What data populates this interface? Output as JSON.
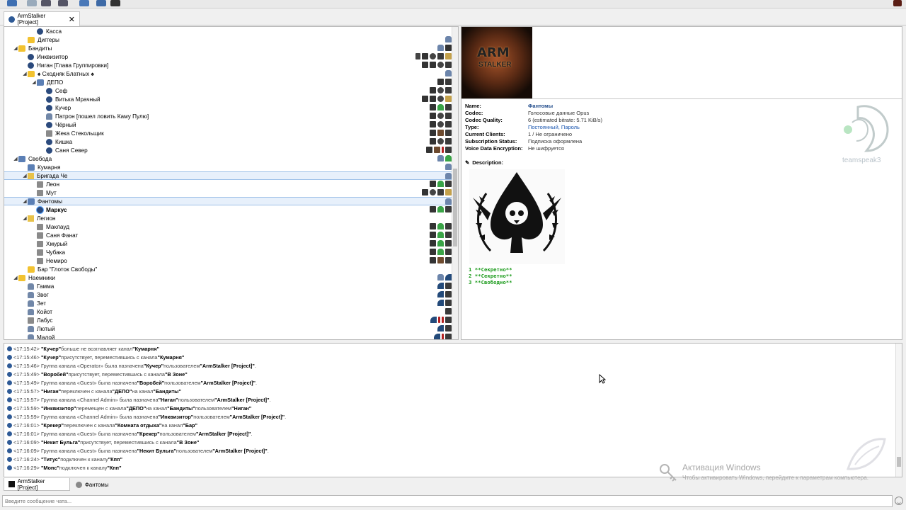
{
  "toolbar": {
    "icons": [
      "connect-icon",
      "disconnect-icon",
      "mute-microphone-icon",
      "mute-speakers-icon",
      "away-icon",
      "bookmarks-icon",
      "identity-icon"
    ]
  },
  "server_tab": {
    "label": "ArmStalker [Project]",
    "close": "✕"
  },
  "tree": {
    "rows": [
      {
        "indent": 4,
        "icon": "user",
        "label": "Касса",
        "badges": []
      },
      {
        "indent": 3,
        "icon": "chan",
        "label": "Диггеры",
        "badges": [
          "lk"
        ]
      },
      {
        "indent": 2,
        "icon": "chan",
        "label": "Бандиты",
        "expanded": true,
        "badges": [
          "lk",
          "g"
        ]
      },
      {
        "indent": 3,
        "icon": "user",
        "label": "Инквизитор",
        "badges": [
          "mic",
          "g",
          "sk",
          "dk",
          "yl"
        ]
      },
      {
        "indent": 3,
        "icon": "user",
        "label": "Ниган [Глава Группировки]",
        "badges": [
          "g",
          "g",
          "sk",
          "dk"
        ]
      },
      {
        "indent": 3,
        "icon": "chan",
        "label": "♠ Сходняк Блатных ♠",
        "expanded": true,
        "badges": [
          "lk"
        ]
      },
      {
        "indent": 4,
        "icon": "chan-blue",
        "label": "ДЕПО",
        "expanded": true,
        "badges": [
          "g",
          "dk"
        ]
      },
      {
        "indent": 5,
        "icon": "user",
        "label": "Сеф",
        "badges": [
          "g",
          "sk",
          "dk"
        ]
      },
      {
        "indent": 5,
        "icon": "user",
        "label": "Витька Мрачный",
        "badges": [
          "g",
          "g",
          "sk",
          "yl"
        ]
      },
      {
        "indent": 5,
        "icon": "user",
        "label": "Кучер",
        "badges": [
          "g",
          "gr",
          "dk"
        ]
      },
      {
        "indent": 5,
        "icon": "lock",
        "label": "Патрон [пошел ловить Каму Пулю]",
        "badges": [
          "g",
          "sk",
          "dk"
        ]
      },
      {
        "indent": 5,
        "icon": "user",
        "label": "Чёрный",
        "badges": [
          "g",
          "sk",
          "dk"
        ]
      },
      {
        "indent": 5,
        "icon": "mute",
        "label": "Жека Стекольщик",
        "badges": [
          "g",
          "br",
          "dk"
        ]
      },
      {
        "indent": 5,
        "icon": "user",
        "label": "Кишка",
        "badges": [
          "g",
          "sk",
          "dk"
        ]
      },
      {
        "indent": 5,
        "icon": "user",
        "label": "Саня Север",
        "badges": [
          "g",
          "br",
          "rd",
          "dk"
        ]
      },
      {
        "indent": 2,
        "icon": "chan-blue",
        "label": "Свобода",
        "expanded": true,
        "badges": [
          "lk",
          "gr"
        ]
      },
      {
        "indent": 3,
        "icon": "chan-blue",
        "label": "Кумарня",
        "badges": [
          "lk"
        ]
      },
      {
        "indent": 3,
        "icon": "flag",
        "label": "Бригада Че",
        "expanded": true,
        "selected": true,
        "badges": [
          "lk"
        ]
      },
      {
        "indent": 4,
        "icon": "mute",
        "label": "Леон",
        "badges": [
          "g",
          "gr",
          "dk"
        ]
      },
      {
        "indent": 4,
        "icon": "mute",
        "label": "Мут",
        "badges": [
          "g",
          "sk",
          "dk",
          "yl"
        ]
      },
      {
        "indent": 3,
        "icon": "chan-blue",
        "label": "Фантомы",
        "expanded": true,
        "selected": true,
        "badges": [
          "lk"
        ]
      },
      {
        "indent": 4,
        "icon": "talk",
        "label": "Маркус",
        "bold": true,
        "badges": [
          "g",
          "gr",
          "dk"
        ]
      },
      {
        "indent": 3,
        "icon": "flag",
        "label": "Легион",
        "expanded": true,
        "badges": []
      },
      {
        "indent": 4,
        "icon": "mute",
        "label": "Маклауд",
        "badges": [
          "g",
          "gr",
          "dk"
        ]
      },
      {
        "indent": 4,
        "icon": "mute",
        "label": "Саня Фанат",
        "badges": [
          "g",
          "gr",
          "dk"
        ]
      },
      {
        "indent": 4,
        "icon": "mute",
        "label": "Хмурый",
        "badges": [
          "g",
          "gr",
          "dk"
        ]
      },
      {
        "indent": 4,
        "icon": "mute",
        "label": "Чубака",
        "badges": [
          "g",
          "gr",
          "dk"
        ]
      },
      {
        "indent": 4,
        "icon": "mute",
        "label": "Немиро",
        "badges": [
          "g",
          "br",
          "dk"
        ]
      },
      {
        "indent": 3,
        "icon": "chan",
        "label": "Бар \"Глоток Свободы\"",
        "badges": []
      },
      {
        "indent": 2,
        "icon": "chan",
        "label": "Наемники",
        "expanded": true,
        "badges": [
          "lk",
          "nv"
        ]
      },
      {
        "indent": 3,
        "icon": "lock",
        "label": "Гамма",
        "badges": [
          "nv",
          "dk"
        ]
      },
      {
        "indent": 3,
        "icon": "lock",
        "label": "Звог",
        "badges": [
          "nv",
          "dk"
        ]
      },
      {
        "indent": 3,
        "icon": "lock",
        "label": "Зет",
        "badges": [
          "nv",
          "dk"
        ]
      },
      {
        "indent": 3,
        "icon": "lock",
        "label": "Койот",
        "badges": [
          "dk"
        ]
      },
      {
        "indent": 3,
        "icon": "mute",
        "label": "Лабус",
        "badges": [
          "nv",
          "rd",
          "rd",
          "dk"
        ]
      },
      {
        "indent": 3,
        "icon": "lock",
        "label": "Лютый",
        "badges": [
          "nv",
          "dk"
        ]
      },
      {
        "indent": 3,
        "icon": "lock",
        "label": "Малой",
        "badges": [
          "nv",
          "rd",
          "dk"
        ]
      }
    ]
  },
  "channel_info": {
    "banner_line1": "ARM",
    "banner_line2": "STALKER",
    "props": [
      {
        "key": "Name:",
        "value": "Фантомы",
        "style": "name"
      },
      {
        "key": "Codec:",
        "value": "Голосовые данные Opus"
      },
      {
        "key": "Codec Quality:",
        "value": "6 (estimated bitrate: 5.71 KiB/s)"
      },
      {
        "key": "Type:",
        "value": "Постоянный, Пароль",
        "style": "link"
      },
      {
        "key": "Current Clients:",
        "value": "1 / Не ограничено"
      },
      {
        "key": "Subscription Status:",
        "value": "Подписка оформлена"
      },
      {
        "key": "Voice Data Encryption:",
        "value": "Не шифруется"
      }
    ],
    "description_label": "Description:",
    "secret_lines": [
      "1 **Секретно**",
      "2 **Секретно**",
      "3 **Свободно**"
    ],
    "logo_text": "teamspeak3"
  },
  "log": {
    "lines": [
      {
        "t": "<17:15:42>",
        "parts": [
          [
            "b",
            "\"Кучер\""
          ],
          [
            "n",
            " больше не возглавляет канал "
          ],
          [
            "b",
            "\"Кумарня\""
          ]
        ]
      },
      {
        "t": "<17:15:46>",
        "parts": [
          [
            "b",
            "\"Кучер\""
          ],
          [
            "n",
            " присутствует, переместившись с канала "
          ],
          [
            "b",
            "\"Кумарня\""
          ]
        ]
      },
      {
        "t": "<17:15:46>",
        "parts": [
          [
            "n",
            "Группа канала «Operator» была назначена "
          ],
          [
            "b",
            "\"Кучер\""
          ],
          [
            "n",
            " пользователем "
          ],
          [
            "b",
            "\"ArmStalker [Project]\""
          ],
          [
            "n",
            "."
          ]
        ]
      },
      {
        "t": "<17:15:49>",
        "parts": [
          [
            "b",
            "\"Воробей\""
          ],
          [
            "n",
            " присутствует, переместившись с канала "
          ],
          [
            "b",
            "\"В Зоне\""
          ]
        ]
      },
      {
        "t": "<17:15:49>",
        "parts": [
          [
            "n",
            "Группа канала «Guest» была назначена "
          ],
          [
            "b",
            "\"Воробей\""
          ],
          [
            "n",
            " пользователем "
          ],
          [
            "b",
            "\"ArmStalker [Project]\""
          ],
          [
            "n",
            "."
          ]
        ]
      },
      {
        "t": "<17:15:57>",
        "parts": [
          [
            "b",
            "\"Ниган\""
          ],
          [
            "n",
            " переключен с канала "
          ],
          [
            "b",
            "\"ДЕПО\""
          ],
          [
            "n",
            " на канал "
          ],
          [
            "b",
            "\"Бандиты\""
          ]
        ]
      },
      {
        "t": "<17:15:57>",
        "parts": [
          [
            "n",
            "Группа канала «Channel Admin» была назначена "
          ],
          [
            "b",
            "\"Ниган\""
          ],
          [
            "n",
            " пользователем "
          ],
          [
            "b",
            "\"ArmStalker [Project]\""
          ],
          [
            "n",
            "."
          ]
        ]
      },
      {
        "t": "<17:15:59>",
        "parts": [
          [
            "b",
            "\"Инквизитор\""
          ],
          [
            "n",
            " перемещен с канала "
          ],
          [
            "b",
            "\"ДЕПО\""
          ],
          [
            "n",
            " на канал "
          ],
          [
            "b",
            "\"Бандиты\""
          ],
          [
            "n",
            " пользователем "
          ],
          [
            "b",
            "\"Ниган\""
          ]
        ]
      },
      {
        "t": "<17:15:59>",
        "parts": [
          [
            "n",
            "Группа канала «Channel Admin» была назначена "
          ],
          [
            "b",
            "\"Инквизитор\""
          ],
          [
            "n",
            " пользователем "
          ],
          [
            "b",
            "\"ArmStalker [Project]\""
          ],
          [
            "n",
            "."
          ]
        ]
      },
      {
        "t": "<17:16:01>",
        "parts": [
          [
            "b",
            "\"Крекер\""
          ],
          [
            "n",
            " переключен с канала "
          ],
          [
            "b",
            "\"Комната отдыха\""
          ],
          [
            "n",
            " на канал "
          ],
          [
            "b",
            "\"Бар\""
          ]
        ]
      },
      {
        "t": "<17:16:01>",
        "parts": [
          [
            "n",
            "Группа канала «Guest» была назначена "
          ],
          [
            "b",
            "\"Крекер\""
          ],
          [
            "n",
            " пользователем "
          ],
          [
            "b",
            "\"ArmStalker [Project]\""
          ],
          [
            "n",
            "."
          ]
        ]
      },
      {
        "t": "<17:16:09>",
        "parts": [
          [
            "b",
            "\"Некит Бульга\""
          ],
          [
            "n",
            " присутствует, переместившись с канала "
          ],
          [
            "b",
            "\"В Зоне\""
          ]
        ]
      },
      {
        "t": "<17:16:09>",
        "parts": [
          [
            "n",
            "Группа канала «Guest» была назначена "
          ],
          [
            "b",
            "\"Некит Бульга\""
          ],
          [
            "n",
            " пользователем "
          ],
          [
            "b",
            "\"ArmStalker [Project]\""
          ],
          [
            "n",
            "."
          ]
        ]
      },
      {
        "t": "<17:16:24>",
        "parts": [
          [
            "b",
            "\"Титус\""
          ],
          [
            "n",
            " подключен к каналу "
          ],
          [
            "b",
            "\"Кпп\""
          ]
        ]
      },
      {
        "t": "<17:16:29>",
        "parts": [
          [
            "b",
            "\"Мопс\""
          ],
          [
            "n",
            " подключен к каналу "
          ],
          [
            "b",
            "\"Кпп\""
          ]
        ]
      }
    ]
  },
  "activation": {
    "title": "Активация Windows",
    "subtitle": "Чтобы активировать Windows, перейдите к параметрам компьютера."
  },
  "chat_tabs": [
    {
      "label": "ArmStalker [Project]"
    },
    {
      "label": "Фантомы"
    }
  ],
  "chat_input": {
    "placeholder": "Введите сообщение чата..."
  }
}
